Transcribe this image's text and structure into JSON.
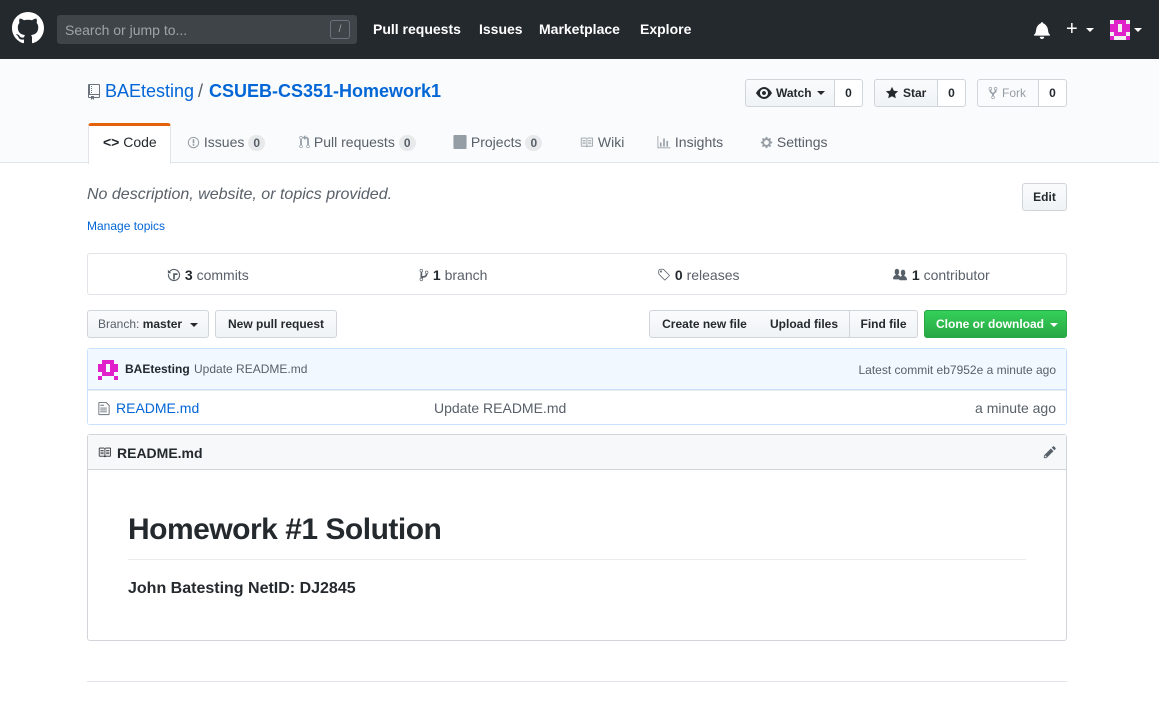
{
  "header": {
    "search_placeholder": "Search or jump to...",
    "slash_key": "/",
    "nav": [
      "Pull requests",
      "Issues",
      "Marketplace",
      "Explore"
    ]
  },
  "repo": {
    "owner": "BAEtesting",
    "separator": "/",
    "name": "CSUEB-CS351-Homework1",
    "watch_label": "Watch",
    "watch_count": "0",
    "star_label": "Star",
    "star_count": "0",
    "fork_label": "Fork",
    "fork_count": "0"
  },
  "tabs": [
    {
      "label": "Code"
    },
    {
      "label": "Issues",
      "count": "0"
    },
    {
      "label": "Pull requests",
      "count": "0"
    },
    {
      "label": "Projects",
      "count": "0"
    },
    {
      "label": "Wiki"
    },
    {
      "label": "Insights"
    },
    {
      "label": "Settings"
    }
  ],
  "description": {
    "text": "No description, website, or topics provided.",
    "manage_topics": "Manage topics",
    "edit_label": "Edit"
  },
  "summary": {
    "commits_num": "3",
    "commits_label": "commits",
    "branch_num": "1",
    "branch_label": "branch",
    "releases_num": "0",
    "releases_label": "releases",
    "contributor_num": "1",
    "contributor_label": "contributor"
  },
  "file_nav": {
    "branch_prefix": "Branch:",
    "branch_name": "master",
    "new_pr": "New pull request",
    "create_file": "Create new file",
    "upload_files": "Upload files",
    "find_file": "Find file",
    "clone": "Clone or download"
  },
  "commit": {
    "author": "BAEtesting",
    "message": "Update README.md",
    "latest_prefix": "Latest commit",
    "sha": "eb7952e",
    "time": "a minute ago"
  },
  "files": [
    {
      "name": "README.md",
      "message": "Update README.md",
      "age": "a minute ago"
    }
  ],
  "readme": {
    "title": "README.md",
    "heading": "Homework #1 Solution",
    "body": "John Batesting NetID: DJ2845"
  },
  "colors": {
    "header_bg": "#24292e",
    "link": "#0366d6",
    "tab_accent": "#e36209",
    "clone_green": "#28a745",
    "avatar_magenta": "#e020c8"
  }
}
